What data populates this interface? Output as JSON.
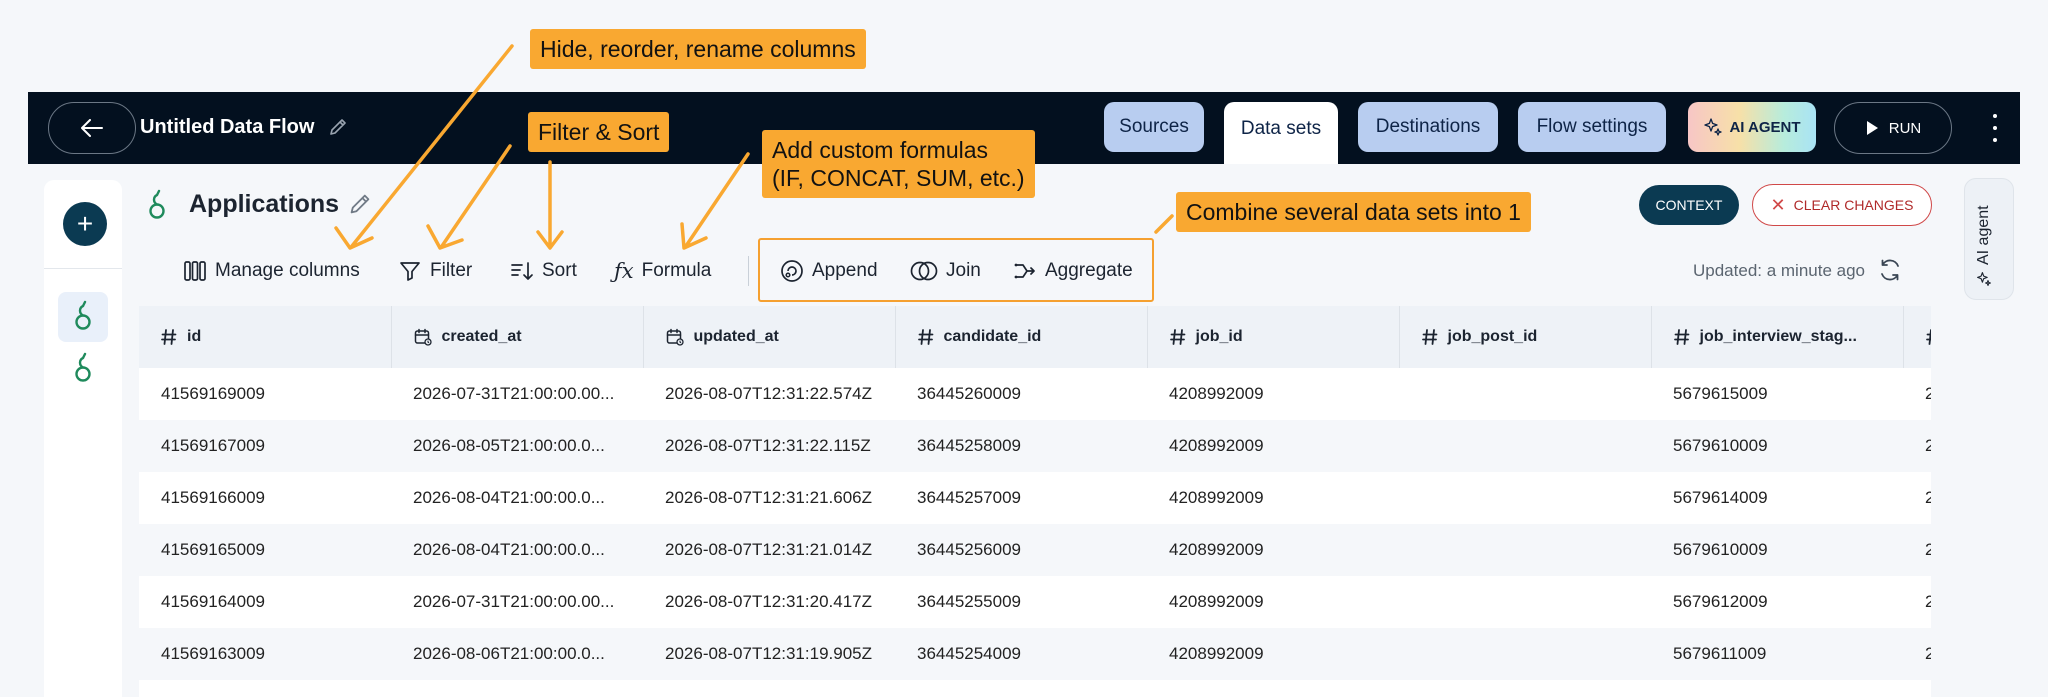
{
  "nav": {
    "title": "Untitled Data Flow",
    "tabs": [
      {
        "label": "Sources",
        "active": false
      },
      {
        "label": "Data sets",
        "active": true
      },
      {
        "label": "Destinations",
        "active": false
      },
      {
        "label": "Flow settings",
        "active": false
      }
    ],
    "ai_agent_label": "AI AGENT",
    "run_label": "RUN"
  },
  "dataset": {
    "title": "Applications"
  },
  "toolbar": {
    "manage_columns": "Manage columns",
    "filter": "Filter",
    "sort": "Sort",
    "formula": "Formula",
    "append": "Append",
    "join": "Join",
    "aggregate": "Aggregate"
  },
  "actions": {
    "context": "CONTEXT",
    "clear_changes": "CLEAR CHANGES",
    "updated": "Updated: a minute ago"
  },
  "side_panel": {
    "ai_agent": "AI agent"
  },
  "table": {
    "columns": [
      {
        "label": "id",
        "icon": "hash-icon"
      },
      {
        "label": "created_at",
        "icon": "calendar-icon"
      },
      {
        "label": "updated_at",
        "icon": "calendar-icon"
      },
      {
        "label": "candidate_id",
        "icon": "hash-icon"
      },
      {
        "label": "job_id",
        "icon": "hash-icon"
      },
      {
        "label": "job_post_id",
        "icon": "hash-icon"
      },
      {
        "label": "job_interview_stag...",
        "icon": "hash-icon"
      }
    ],
    "rows": [
      [
        "41569169009",
        "2026-07-31T21:00:00.00...",
        "2026-08-07T12:31:22.574Z",
        "36445260009",
        "4208992009",
        "",
        "5679615009",
        "2"
      ],
      [
        "41569167009",
        "2026-08-05T21:00:00.0...",
        "2026-08-07T12:31:22.115Z",
        "36445258009",
        "4208992009",
        "",
        "5679610009",
        "2"
      ],
      [
        "41569166009",
        "2026-08-04T21:00:00.0...",
        "2026-08-07T12:31:21.606Z",
        "36445257009",
        "4208992009",
        "",
        "5679614009",
        "2"
      ],
      [
        "41569165009",
        "2026-08-04T21:00:00.0...",
        "2026-08-07T12:31:21.014Z",
        "36445256009",
        "4208992009",
        "",
        "5679610009",
        "2"
      ],
      [
        "41569164009",
        "2026-07-31T21:00:00.00...",
        "2026-08-07T12:31:20.417Z",
        "36445255009",
        "4208992009",
        "",
        "5679612009",
        "2"
      ],
      [
        "41569163009",
        "2026-08-06T21:00:00.0...",
        "2026-08-07T12:31:19.905Z",
        "36445254009",
        "4208992009",
        "",
        "5679611009",
        "2"
      ]
    ]
  },
  "annotations": {
    "manage": "Hide, reorder, rename columns",
    "filter_sort": "Filter & Sort",
    "formula_line1": "Add custom formulas",
    "formula_line2": "(IF, CONCAT, SUM, etc.)",
    "combine": "Combine several data sets into 1"
  },
  "colors": {
    "nav_bg": "#03101f",
    "tab_bg": "#b8cdf0",
    "accent_dark": "#0b3a52",
    "callout": "#f9a831",
    "clear_red": "#d04848",
    "icon_green": "#1f8a5c"
  }
}
